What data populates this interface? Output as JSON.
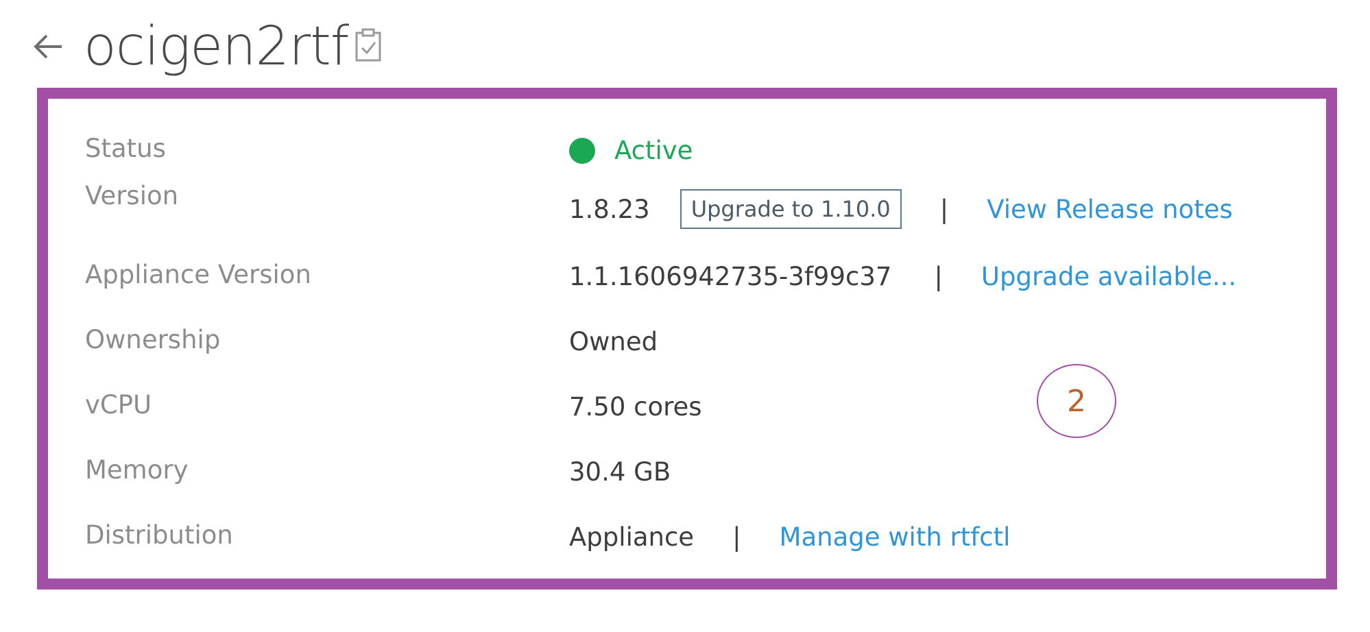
{
  "header": {
    "back_icon": "arrow-left-icon",
    "title": "ocigen2rtf",
    "copy_icon": "clipboard-check-icon"
  },
  "details": {
    "status": {
      "label": "Status",
      "value": "Active",
      "color": "#1aa855"
    },
    "version": {
      "label": "Version",
      "value": "1.8.23",
      "upgrade_button": "Upgrade to 1.10.0",
      "separator": "|",
      "link": "View Release notes"
    },
    "appliance_version": {
      "label": "Appliance Version",
      "value": "1.1.1606942735-3f99c37",
      "separator": "|",
      "link": "Upgrade available..."
    },
    "ownership": {
      "label": "Ownership",
      "value": "Owned"
    },
    "vcpu": {
      "label": "vCPU",
      "value": "7.50 cores"
    },
    "memory": {
      "label": "Memory",
      "value": "30.4 GB"
    },
    "distribution": {
      "label": "Distribution",
      "value": "Appliance",
      "separator": "|",
      "link": "Manage with rtfctl"
    }
  },
  "annotation": {
    "step_number": "2",
    "highlight_color": "#a24fa6"
  },
  "colors": {
    "link": "#2f95d6",
    "label": "#8c8c8c",
    "value": "#3d3d3d"
  }
}
